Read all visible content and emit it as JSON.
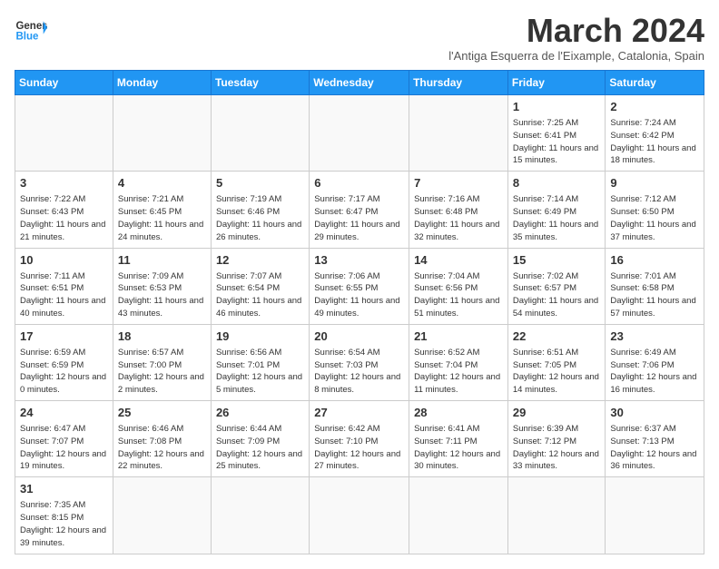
{
  "logo": {
    "text_general": "General",
    "text_blue": "Blue"
  },
  "header": {
    "month": "March 2024",
    "subtitle": "l'Antiga Esquerra de l'Eixample, Catalonia, Spain"
  },
  "days_of_week": [
    "Sunday",
    "Monday",
    "Tuesday",
    "Wednesday",
    "Thursday",
    "Friday",
    "Saturday"
  ],
  "weeks": [
    [
      {
        "day": "",
        "info": ""
      },
      {
        "day": "",
        "info": ""
      },
      {
        "day": "",
        "info": ""
      },
      {
        "day": "",
        "info": ""
      },
      {
        "day": "",
        "info": ""
      },
      {
        "day": "1",
        "info": "Sunrise: 7:25 AM\nSunset: 6:41 PM\nDaylight: 11 hours and 15 minutes."
      },
      {
        "day": "2",
        "info": "Sunrise: 7:24 AM\nSunset: 6:42 PM\nDaylight: 11 hours and 18 minutes."
      }
    ],
    [
      {
        "day": "3",
        "info": "Sunrise: 7:22 AM\nSunset: 6:43 PM\nDaylight: 11 hours and 21 minutes."
      },
      {
        "day": "4",
        "info": "Sunrise: 7:21 AM\nSunset: 6:45 PM\nDaylight: 11 hours and 24 minutes."
      },
      {
        "day": "5",
        "info": "Sunrise: 7:19 AM\nSunset: 6:46 PM\nDaylight: 11 hours and 26 minutes."
      },
      {
        "day": "6",
        "info": "Sunrise: 7:17 AM\nSunset: 6:47 PM\nDaylight: 11 hours and 29 minutes."
      },
      {
        "day": "7",
        "info": "Sunrise: 7:16 AM\nSunset: 6:48 PM\nDaylight: 11 hours and 32 minutes."
      },
      {
        "day": "8",
        "info": "Sunrise: 7:14 AM\nSunset: 6:49 PM\nDaylight: 11 hours and 35 minutes."
      },
      {
        "day": "9",
        "info": "Sunrise: 7:12 AM\nSunset: 6:50 PM\nDaylight: 11 hours and 37 minutes."
      }
    ],
    [
      {
        "day": "10",
        "info": "Sunrise: 7:11 AM\nSunset: 6:51 PM\nDaylight: 11 hours and 40 minutes."
      },
      {
        "day": "11",
        "info": "Sunrise: 7:09 AM\nSunset: 6:53 PM\nDaylight: 11 hours and 43 minutes."
      },
      {
        "day": "12",
        "info": "Sunrise: 7:07 AM\nSunset: 6:54 PM\nDaylight: 11 hours and 46 minutes."
      },
      {
        "day": "13",
        "info": "Sunrise: 7:06 AM\nSunset: 6:55 PM\nDaylight: 11 hours and 49 minutes."
      },
      {
        "day": "14",
        "info": "Sunrise: 7:04 AM\nSunset: 6:56 PM\nDaylight: 11 hours and 51 minutes."
      },
      {
        "day": "15",
        "info": "Sunrise: 7:02 AM\nSunset: 6:57 PM\nDaylight: 11 hours and 54 minutes."
      },
      {
        "day": "16",
        "info": "Sunrise: 7:01 AM\nSunset: 6:58 PM\nDaylight: 11 hours and 57 minutes."
      }
    ],
    [
      {
        "day": "17",
        "info": "Sunrise: 6:59 AM\nSunset: 6:59 PM\nDaylight: 12 hours and 0 minutes."
      },
      {
        "day": "18",
        "info": "Sunrise: 6:57 AM\nSunset: 7:00 PM\nDaylight: 12 hours and 2 minutes."
      },
      {
        "day": "19",
        "info": "Sunrise: 6:56 AM\nSunset: 7:01 PM\nDaylight: 12 hours and 5 minutes."
      },
      {
        "day": "20",
        "info": "Sunrise: 6:54 AM\nSunset: 7:03 PM\nDaylight: 12 hours and 8 minutes."
      },
      {
        "day": "21",
        "info": "Sunrise: 6:52 AM\nSunset: 7:04 PM\nDaylight: 12 hours and 11 minutes."
      },
      {
        "day": "22",
        "info": "Sunrise: 6:51 AM\nSunset: 7:05 PM\nDaylight: 12 hours and 14 minutes."
      },
      {
        "day": "23",
        "info": "Sunrise: 6:49 AM\nSunset: 7:06 PM\nDaylight: 12 hours and 16 minutes."
      }
    ],
    [
      {
        "day": "24",
        "info": "Sunrise: 6:47 AM\nSunset: 7:07 PM\nDaylight: 12 hours and 19 minutes."
      },
      {
        "day": "25",
        "info": "Sunrise: 6:46 AM\nSunset: 7:08 PM\nDaylight: 12 hours and 22 minutes."
      },
      {
        "day": "26",
        "info": "Sunrise: 6:44 AM\nSunset: 7:09 PM\nDaylight: 12 hours and 25 minutes."
      },
      {
        "day": "27",
        "info": "Sunrise: 6:42 AM\nSunset: 7:10 PM\nDaylight: 12 hours and 27 minutes."
      },
      {
        "day": "28",
        "info": "Sunrise: 6:41 AM\nSunset: 7:11 PM\nDaylight: 12 hours and 30 minutes."
      },
      {
        "day": "29",
        "info": "Sunrise: 6:39 AM\nSunset: 7:12 PM\nDaylight: 12 hours and 33 minutes."
      },
      {
        "day": "30",
        "info": "Sunrise: 6:37 AM\nSunset: 7:13 PM\nDaylight: 12 hours and 36 minutes."
      }
    ],
    [
      {
        "day": "31",
        "info": "Sunrise: 7:35 AM\nSunset: 8:15 PM\nDaylight: 12 hours and 39 minutes."
      },
      {
        "day": "",
        "info": ""
      },
      {
        "day": "",
        "info": ""
      },
      {
        "day": "",
        "info": ""
      },
      {
        "day": "",
        "info": ""
      },
      {
        "day": "",
        "info": ""
      },
      {
        "day": "",
        "info": ""
      }
    ]
  ]
}
